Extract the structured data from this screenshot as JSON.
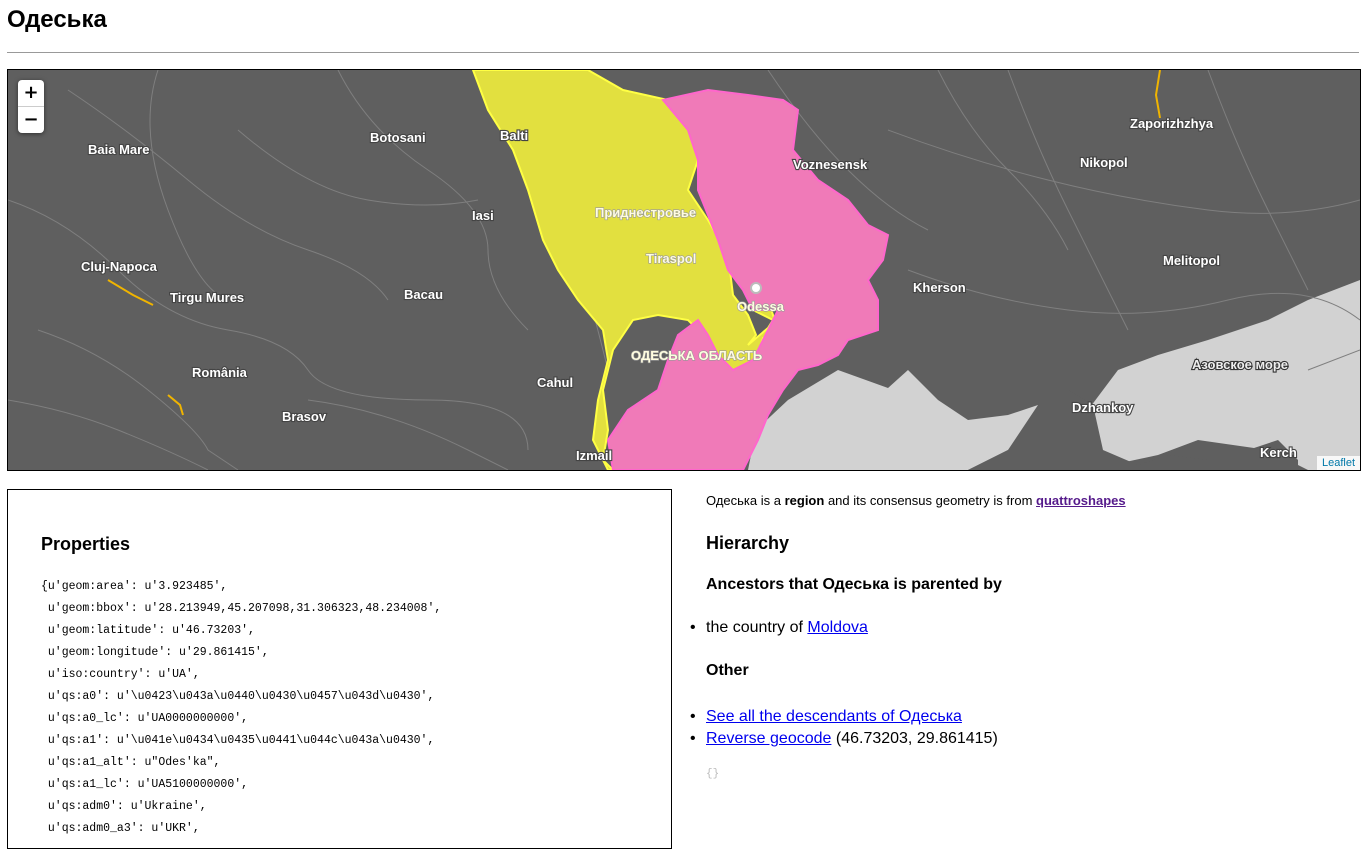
{
  "page": {
    "title": "Одеська"
  },
  "map": {
    "zoom_in": "+",
    "zoom_out": "−",
    "attribution": "Leaflet",
    "colors": {
      "background": "#5f5f5f",
      "water": "#cfcfcf",
      "moldova": "#e2e03f",
      "odeska": "#f07ab8",
      "moldova_border": "#ffff44",
      "odeska_border": "#ff66cc"
    },
    "labels": {
      "baia_mare": "Baia Mare",
      "botosani": "Botosani",
      "balti": "Balti",
      "iasi": "Iasi",
      "cluj": "Cluj-Napoca",
      "tirgu": "Tirgu Mures",
      "bacau": "Bacau",
      "romania": "România",
      "brasov": "Brasov",
      "cahul": "Cahul",
      "izmail": "Izmail",
      "pridn": "Приднестровье",
      "tiraspol": "Tiraspol",
      "odessa": "Odessa",
      "odeska_oblast": "ОДЕСЬКА ОБЛАСТЬ",
      "voznesensk": "Voznesensk",
      "kherson": "Kherson",
      "nikopol": "Nikopol",
      "zaporizhzhya": "Zaporizhzhya",
      "melitopol": "Melitopol",
      "azov": "Азовское море",
      "dzhankoy": "Dzhankoy",
      "kerch": "Kerch"
    }
  },
  "properties": {
    "heading": "Properties",
    "lines": [
      "{u'geom:area': u'3.923485',",
      " u'geom:bbox': u'28.213949,45.207098,31.306323,48.234008',",
      " u'geom:latitude': u'46.73203',",
      " u'geom:longitude': u'29.861415',",
      " u'iso:country': u'UA',",
      " u'qs:a0': u'\\u0423\\u043a\\u0440\\u0430\\u0457\\u043d\\u0430',",
      " u'qs:a0_lc': u'UA0000000000',",
      " u'qs:a1': u'\\u041e\\u0434\\u0435\\u0441\\u044c\\u043a\\u0430',",
      " u'qs:a1_alt': u\"Odes'ka\",",
      " u'qs:a1_lc': u'UA5100000000',",
      " u'qs:adm0': u'Ukraine',",
      " u'qs:adm0_a3': u'UKR',"
    ]
  },
  "info": {
    "summary_name": "Одеська",
    "summary_is": " is a ",
    "summary_type": "region",
    "summary_mid": " and its consensus geometry is from ",
    "summary_source": "quattroshapes",
    "hierarchy_title": "Hierarchy",
    "ancestors_title": "Ancestors that Одеська is parented by",
    "ancestor_prefix": "the country of ",
    "ancestor_link": "Moldova",
    "other_title": "Other",
    "descendants_link": "See all the descendants of Одеська",
    "reverse_link": "Reverse geocode",
    "reverse_coords": " (46.73203, 29.861415)",
    "empty_json": "{}",
    "bullet": "•"
  }
}
